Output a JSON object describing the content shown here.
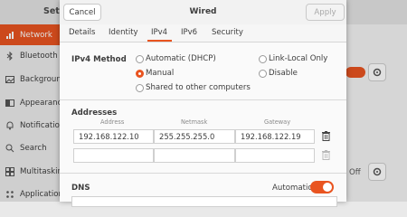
{
  "background": {
    "title_fragment": "Setti",
    "sidebar": [
      {
        "label": "Network",
        "icon": "network-icon",
        "active": true
      },
      {
        "label": "Bluetooth",
        "icon": "bluetooth-icon"
      },
      {
        "label": "Backgroun",
        "icon": "background-icon"
      },
      {
        "label": "Appearanc",
        "icon": "appearance-icon"
      },
      {
        "label": "Notificatio",
        "icon": "notifications-icon"
      },
      {
        "label": "Search",
        "icon": "search-icon"
      },
      {
        "label": "Multitaskin",
        "icon": "multitasking-icon"
      },
      {
        "label": "Application",
        "icon": "applications-icon"
      }
    ],
    "off_label": "Off"
  },
  "dialog": {
    "title": "Wired",
    "cancel_label": "Cancel",
    "apply_label": "Apply",
    "tabs": [
      "Details",
      "Identity",
      "IPv4",
      "IPv6",
      "Security"
    ],
    "active_tab": "IPv4",
    "ipv4_method_label": "IPv4 Method",
    "methods": {
      "automatic": "Automatic (DHCP)",
      "link_local": "Link-Local Only",
      "manual": "Manual",
      "disable": "Disable",
      "shared": "Shared to other computers"
    },
    "selected_method": "Manual",
    "addresses_label": "Addresses",
    "columns": [
      "Address",
      "Netmask",
      "Gateway"
    ],
    "rows": [
      {
        "address": "192.168.122.10",
        "netmask": "255.255.255.0",
        "gateway": "192.168.122.19"
      },
      {
        "address": "",
        "netmask": "",
        "gateway": ""
      }
    ],
    "dns_label": "DNS",
    "dns_automatic_label": "Automatic",
    "dns_automatic_on": true
  },
  "colors": {
    "accent": "#e95420"
  }
}
